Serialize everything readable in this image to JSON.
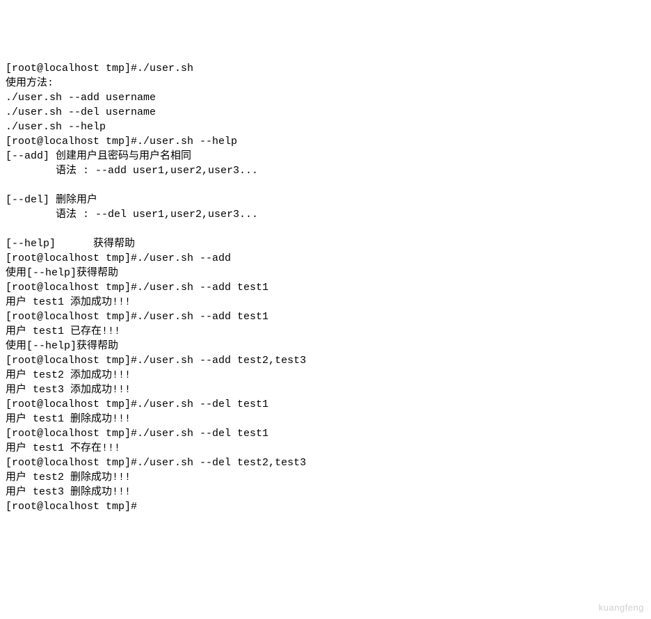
{
  "terminal": {
    "lines": [
      "[root@localhost tmp]#./user.sh",
      "使用方法:",
      "./user.sh --add username",
      "./user.sh --del username",
      "./user.sh --help",
      "[root@localhost tmp]#./user.sh --help",
      "[--add] 创建用户且密码与用户名相同",
      "        语法 : --add user1,user2,user3...",
      "",
      "[--del] 删除用户",
      "        语法 : --del user1,user2,user3...",
      "",
      "[--help]      获得帮助",
      "[root@localhost tmp]#./user.sh --add",
      "使用[--help]获得帮助",
      "[root@localhost tmp]#./user.sh --add test1",
      "用户 test1 添加成功!!!",
      "[root@localhost tmp]#./user.sh --add test1",
      "用户 test1 已存在!!!",
      "使用[--help]获得帮助",
      "[root@localhost tmp]#./user.sh --add test2,test3",
      "用户 test2 添加成功!!!",
      "用户 test3 添加成功!!!",
      "[root@localhost tmp]#./user.sh --del test1",
      "用户 test1 删除成功!!!",
      "[root@localhost tmp]#./user.sh --del test1",
      "用户 test1 不存在!!!",
      "[root@localhost tmp]#./user.sh --del test2,test3",
      "用户 test2 删除成功!!!",
      "用户 test3 删除成功!!!",
      "[root@localhost tmp]#"
    ]
  },
  "watermark": "kuangfeng"
}
